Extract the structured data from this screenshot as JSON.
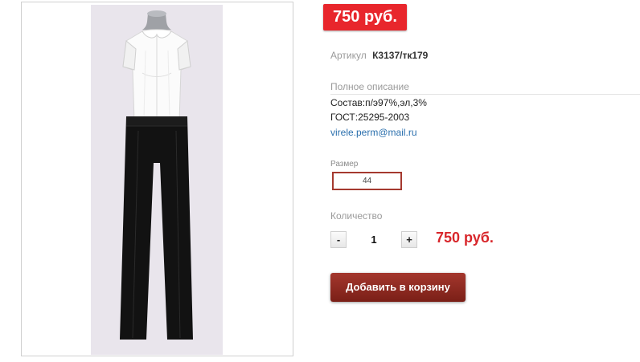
{
  "product": {
    "price_badge": "750 руб.",
    "sku_label": "Артикул",
    "sku_value": "К3137/тк179",
    "description_title": "Полное описание",
    "description_lines": [
      "Состав:п/э97%,эл,3%",
      "ГОСТ:25295-2003",
      "virele.perm@mail.ru"
    ],
    "size_label": "Размер",
    "size_selected": "44",
    "quantity_label": "Количество",
    "quantity_minus": "-",
    "quantity_value": "1",
    "quantity_plus": "+",
    "total_price": "750 руб.",
    "add_to_cart_label": "Добавить в корзину"
  },
  "colors": {
    "price_red": "#e8262c",
    "button_brown": "#8c2a20",
    "link_blue": "#2a6fad",
    "photo_background": "#e9e5ec"
  },
  "image": {
    "subject": "mannequin wearing white short-sleeve blouse and black trousers"
  }
}
